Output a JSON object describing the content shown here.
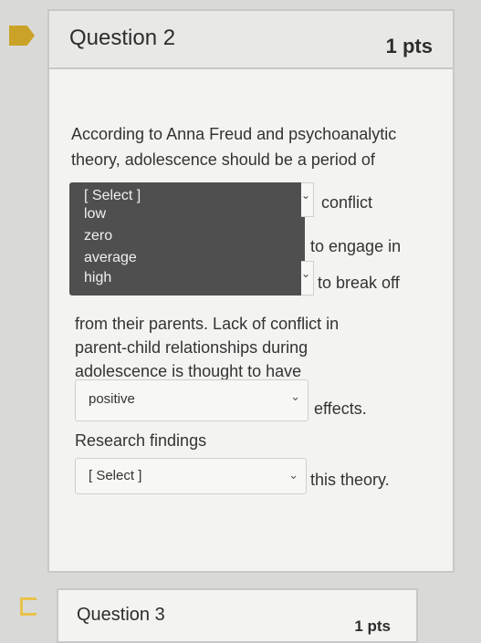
{
  "question2": {
    "title": "Question 2",
    "points": "1 pts",
    "line1": "According to Anna Freud and psychoanalytic",
    "line2": "theory, adolescence should be a period of",
    "dropdown": {
      "options": [
        "[ Select ]",
        "low",
        "zero",
        "average",
        "high"
      ],
      "selected": "[ Select ]"
    },
    "after_blank1": "conflict",
    "after_blank2": "to engage in",
    "after_blank3": "to break off",
    "para1": "from their parents. Lack of conflict in",
    "para2": "parent-child relationships during",
    "para3": "adolescence is thought to have",
    "blank4_value": "positive",
    "after_blank4": "effects.",
    "research_label": "Research findings",
    "blank5_value": "[ Select ]",
    "after_blank5": "this theory."
  },
  "question3": {
    "title": "Question 3",
    "points": "1 pts"
  },
  "icons": {
    "chevron": "chevron-down-icon",
    "check": "checkmark-icon",
    "flag": "flag-icon"
  }
}
